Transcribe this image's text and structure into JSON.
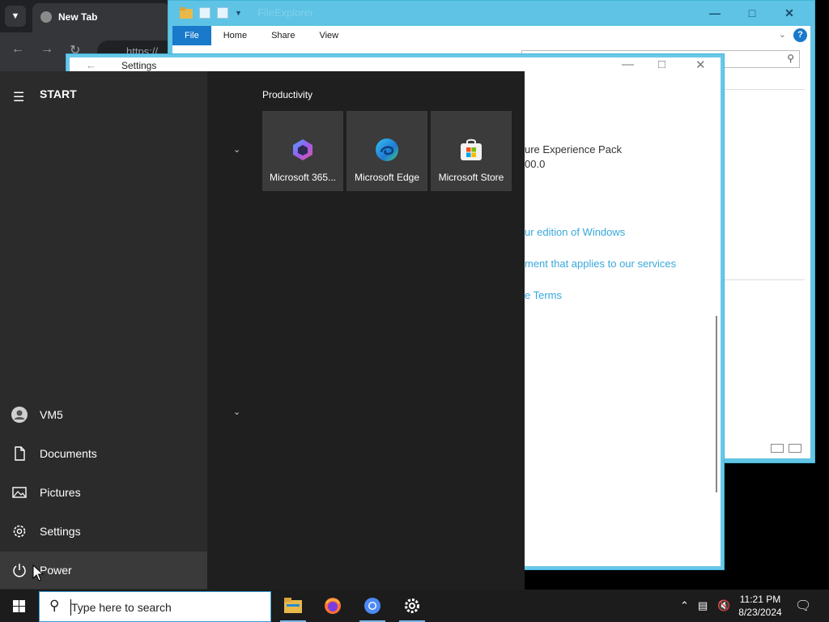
{
  "browser": {
    "tab_title": "New Tab",
    "url_partial": "https://"
  },
  "explorer": {
    "title": "FileExplorer",
    "ribbon_tabs": [
      "File",
      "Home",
      "Share",
      "View"
    ],
    "help": "?"
  },
  "settings": {
    "title": "Settings",
    "lines": [
      {
        "text": "ure Experience Pack",
        "link": false
      },
      {
        "text": "00.0",
        "link": false
      },
      {
        "text": "ur edition of Windows",
        "link": true
      },
      {
        "text": "ment that applies to our services",
        "link": true
      },
      {
        "text": "e Terms",
        "link": true
      }
    ]
  },
  "start_menu": {
    "header": "START",
    "group_title": "Productivity",
    "tiles": [
      {
        "label": "Microsoft 365...",
        "icon": "microsoft-365-icon"
      },
      {
        "label": "Microsoft Edge",
        "icon": "edge-icon"
      },
      {
        "label": "Microsoft Store",
        "icon": "store-icon"
      }
    ],
    "nav_items": [
      {
        "label": "VM5",
        "icon": "user-icon"
      },
      {
        "label": "Documents",
        "icon": "document-icon"
      },
      {
        "label": "Pictures",
        "icon": "pictures-icon"
      },
      {
        "label": "Settings",
        "icon": "gear-icon"
      },
      {
        "label": "Power",
        "icon": "power-icon"
      }
    ]
  },
  "taskbar": {
    "search_placeholder": "Type here to search",
    "apps": [
      "file-explorer-icon",
      "firefox-icon",
      "chrome-icon",
      "settings-icon"
    ],
    "time": "11:21 PM",
    "date": "8/23/2024"
  }
}
